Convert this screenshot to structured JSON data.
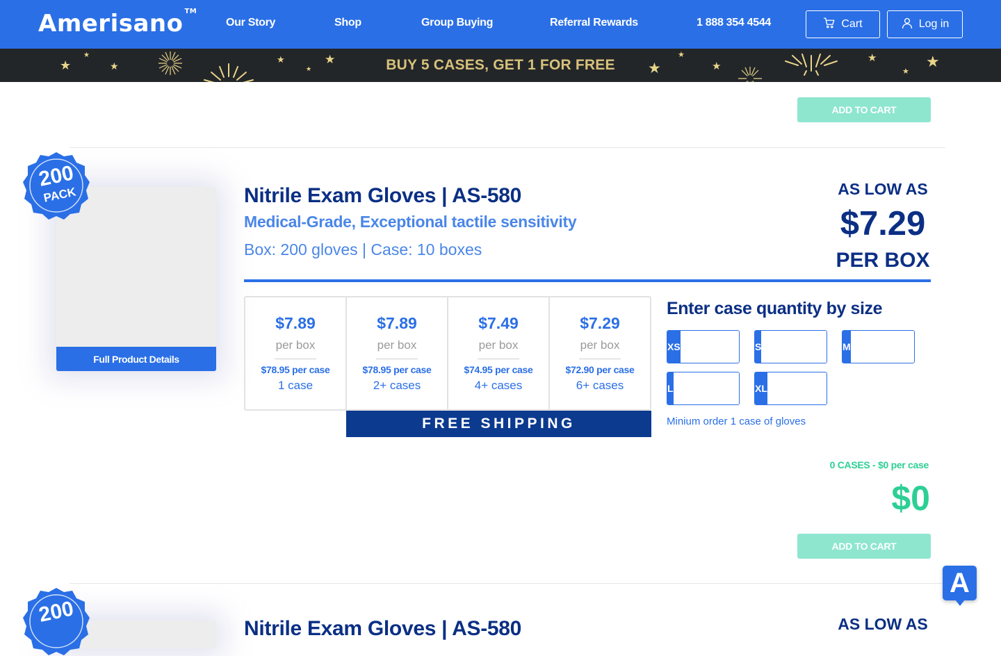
{
  "header": {
    "logo": "Amerisano",
    "logo_tm": "TM",
    "nav": [
      "Our Story",
      "Shop",
      "Group Buying",
      "Referral Rewards"
    ],
    "phone": "1 888 354 4544",
    "cart_label": "Cart",
    "login_label": "Log in"
  },
  "promo": {
    "text": "BUY 5 CASES, GET 1 FOR FREE"
  },
  "prev_product": {
    "add_to_cart": "ADD TO CART"
  },
  "product": {
    "badge_count": "200",
    "badge_unit": "PACK",
    "details_button": "Full Product Details",
    "title": "Nitrile Exam Gloves | AS-580",
    "subtitle": "Medical-Grade, Exceptional tactile sensitivity",
    "pack_info": "Box: 200 gloves | Case: 10 boxes",
    "low_as_label": "AS LOW AS",
    "low_price": "$7.29",
    "per_box_label": "PER BOX",
    "tiers": [
      {
        "price": "$7.89",
        "per_box": "per box",
        "per_case": "$78.95 per case",
        "cases": "1 case"
      },
      {
        "price": "$7.89",
        "per_box": "per box",
        "per_case": "$78.95 per case",
        "cases": "2+ cases"
      },
      {
        "price": "$7.49",
        "per_box": "per box",
        "per_case": "$74.95 per case",
        "cases": "4+ cases"
      },
      {
        "price": "$7.29",
        "per_box": "per box",
        "per_case": "$72.90 per case",
        "cases": "6+ cases"
      }
    ],
    "shipping": "FREE SHIPPING",
    "qty_title": "Enter case quantity by size",
    "sizes": [
      "XS",
      "S",
      "M",
      "L",
      "XL"
    ],
    "size_values": [
      "",
      "",
      "",
      "",
      ""
    ],
    "min_note": "Minium order 1 case of gloves",
    "cases_summary": "0 CASES - $0 per case",
    "total": "$0",
    "add_to_cart": "ADD TO CART"
  },
  "next_product": {
    "badge_count": "200",
    "title": "Nitrile Exam Gloves | AS-580",
    "low_as_label": "AS LOW AS"
  },
  "fab": {
    "label": "A"
  },
  "colors": {
    "brand_blue": "#2a6fe6",
    "navy": "#0b2f84",
    "mint": "#8ee6cf",
    "green": "#2dcf95",
    "promo_bg": "#232629",
    "promo_text": "#d7c27a"
  }
}
